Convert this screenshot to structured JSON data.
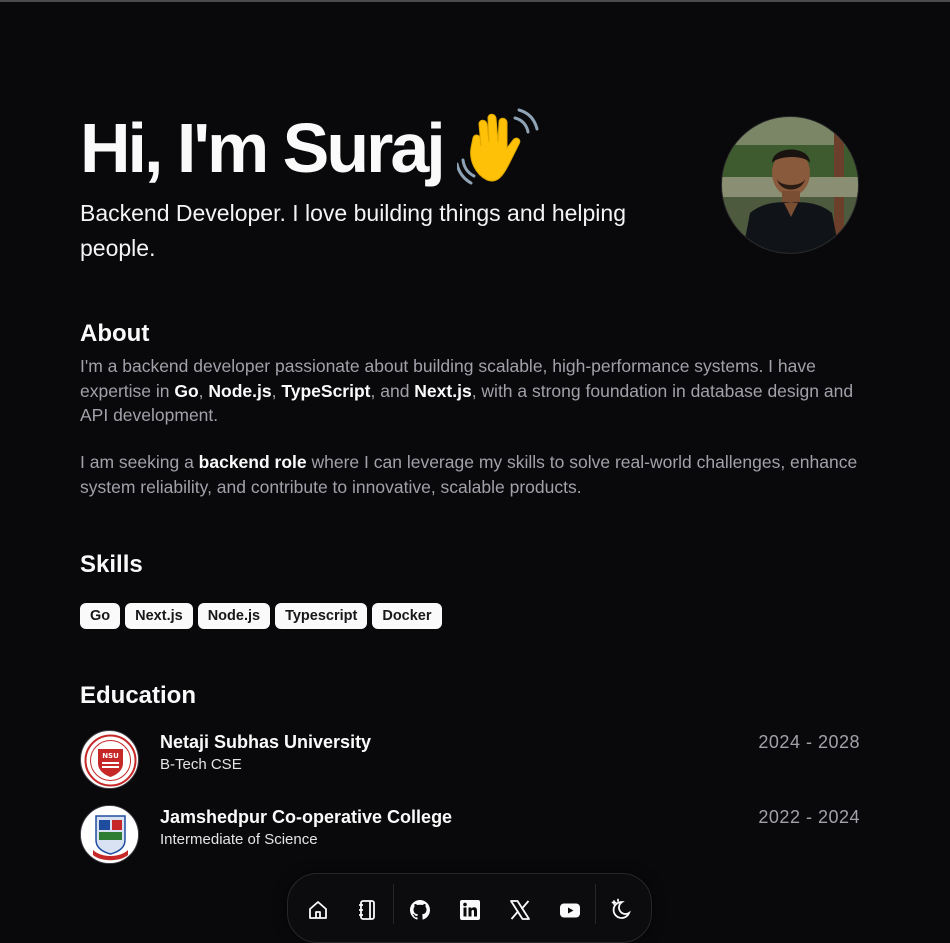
{
  "hero": {
    "greeting": "Hi, I'm Suraj",
    "subtitle": "Backend Developer. I love building things and helping people."
  },
  "about": {
    "title": "About",
    "p1_part1": "I'm a backend developer passionate about building scalable, high-performance systems. I have expertise in ",
    "skill_go": "Go",
    "sep1": ", ",
    "skill_node": "Node.js",
    "sep2": ", ",
    "skill_ts": "TypeScript",
    "sep3": ", and ",
    "skill_next": "Next.js",
    "p1_part2": ", with a strong foundation in database design and API development.",
    "p2_part1": "I am seeking a ",
    "p2_bold": "backend role",
    "p2_part2": " where I can leverage my skills to solve real-world challenges, enhance system reliability, and contribute to innovative, scalable products."
  },
  "skills": {
    "title": "Skills",
    "items": [
      "Go",
      "Next.js",
      "Node.js",
      "Typescript",
      "Docker"
    ]
  },
  "education": {
    "title": "Education",
    "items": [
      {
        "name": "Netaji Subhas University",
        "degree": "B-Tech CSE",
        "years": "2024 - 2028",
        "logo_text": "NSU"
      },
      {
        "name": "Jamshedpur Co-operative College",
        "degree": "Intermediate of Science",
        "years": "2022 - 2024"
      }
    ]
  },
  "dock": {
    "icons": [
      "home-icon",
      "notebook-icon",
      "github-icon",
      "linkedin-icon",
      "x-icon",
      "youtube-icon",
      "theme-toggle-icon"
    ]
  },
  "colors": {
    "background": "#09090b",
    "text": "#fafafa",
    "muted": "#a1a1aa",
    "chip_bg": "#fafafa"
  }
}
